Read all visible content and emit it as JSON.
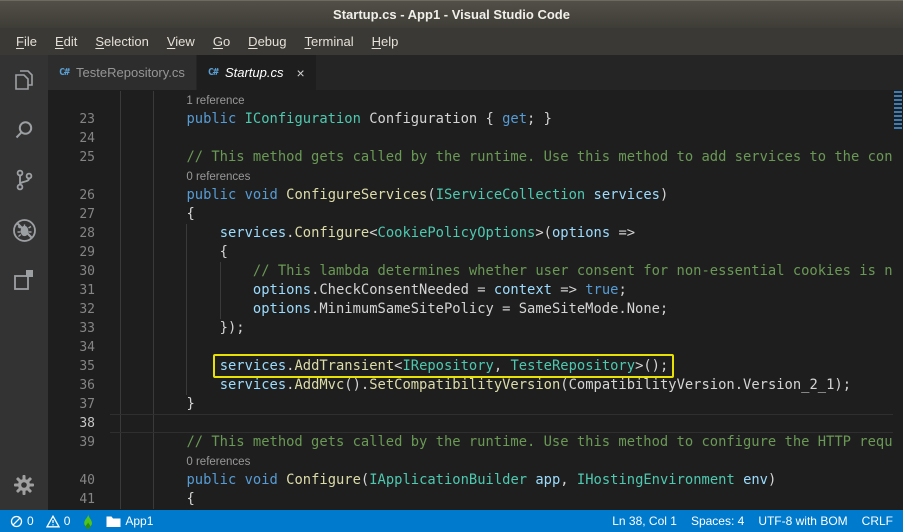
{
  "window": {
    "title": "Startup.cs - App1 - Visual Studio Code"
  },
  "menu": {
    "items": [
      "File",
      "Edit",
      "Selection",
      "View",
      "Go",
      "Debug",
      "Terminal",
      "Help"
    ]
  },
  "activity_bar": {
    "items": [
      {
        "icon": "explorer-icon"
      },
      {
        "icon": "search-icon"
      },
      {
        "icon": "source-control-icon"
      },
      {
        "icon": "debug-icon"
      },
      {
        "icon": "extensions-icon"
      }
    ],
    "bottom_items": [
      {
        "icon": "settings-gear-icon"
      }
    ]
  },
  "tabs": [
    {
      "label": "TesteRepository.cs",
      "icon": "csharp-file-icon",
      "active": false,
      "closable": false
    },
    {
      "label": "Startup.cs",
      "icon": "csharp-file-icon",
      "active": true,
      "preview_italic": true,
      "closable": true,
      "close_glyph": "×"
    }
  ],
  "colors": {
    "accent_blue": "#007acc",
    "keyword": "#569cd6",
    "type": "#4ec9b0",
    "method": "#dcdcaa",
    "variable": "#9cdcfe",
    "comment": "#6a9955",
    "plain": "#d4d4d4",
    "codelens": "#999999",
    "annotation_yellow": "#e8e204"
  },
  "editor": {
    "annotation": {
      "type": "highlight-box",
      "line": 35
    },
    "current_line": 38,
    "rows": [
      {
        "kind": "lens",
        "indent": 8,
        "text": "1 reference",
        "guides": [
          0,
          4
        ]
      },
      {
        "kind": "code",
        "num": "23",
        "guides": [
          0,
          4
        ],
        "tokens": [
          [
            "pl",
            "        "
          ],
          [
            "kw",
            "public"
          ],
          [
            "pl",
            " "
          ],
          [
            "ty",
            "IConfiguration"
          ],
          [
            "pl",
            " Configuration { "
          ],
          [
            "kw",
            "get"
          ],
          [
            "pl",
            "; }"
          ]
        ]
      },
      {
        "kind": "code",
        "num": "24",
        "guides": [
          0,
          4
        ],
        "tokens": []
      },
      {
        "kind": "code",
        "num": "25",
        "guides": [
          0,
          4
        ],
        "tokens": [
          [
            "pl",
            "        "
          ],
          [
            "cm",
            "// This method gets called by the runtime. Use this method to add services to the container."
          ]
        ]
      },
      {
        "kind": "lens",
        "indent": 8,
        "text": "0 references",
        "guides": [
          0,
          4
        ]
      },
      {
        "kind": "code",
        "num": "26",
        "guides": [
          0,
          4
        ],
        "tokens": [
          [
            "pl",
            "        "
          ],
          [
            "kw",
            "public"
          ],
          [
            "pl",
            " "
          ],
          [
            "kw",
            "void"
          ],
          [
            "pl",
            " "
          ],
          [
            "fn",
            "ConfigureServices"
          ],
          [
            "pl",
            "("
          ],
          [
            "ty",
            "IServiceCollection"
          ],
          [
            "pl",
            " "
          ],
          [
            "va",
            "services"
          ],
          [
            "pl",
            ")"
          ]
        ]
      },
      {
        "kind": "code",
        "num": "27",
        "guides": [
          0,
          4
        ],
        "tokens": [
          [
            "pl",
            "        {"
          ]
        ]
      },
      {
        "kind": "code",
        "num": "28",
        "guides": [
          0,
          4,
          8
        ],
        "tokens": [
          [
            "pl",
            "            "
          ],
          [
            "va",
            "services"
          ],
          [
            "pl",
            "."
          ],
          [
            "fn",
            "Configure"
          ],
          [
            "pl",
            "<"
          ],
          [
            "ty",
            "CookiePolicyOptions"
          ],
          [
            "pl",
            ">("
          ],
          [
            "va",
            "options"
          ],
          [
            "pl",
            " =>"
          ]
        ]
      },
      {
        "kind": "code",
        "num": "29",
        "guides": [
          0,
          4,
          8
        ],
        "tokens": [
          [
            "pl",
            "            {"
          ]
        ]
      },
      {
        "kind": "code",
        "num": "30",
        "guides": [
          0,
          4,
          8,
          12
        ],
        "tokens": [
          [
            "pl",
            "                "
          ],
          [
            "cm",
            "// This lambda determines whether user consent for non-essential cookies is needed for a given request."
          ]
        ]
      },
      {
        "kind": "code",
        "num": "31",
        "guides": [
          0,
          4,
          8,
          12
        ],
        "tokens": [
          [
            "pl",
            "                "
          ],
          [
            "va",
            "options"
          ],
          [
            "pl",
            ".CheckConsentNeeded = "
          ],
          [
            "va",
            "context"
          ],
          [
            "pl",
            " => "
          ],
          [
            "kw",
            "true"
          ],
          [
            "pl",
            ";"
          ]
        ]
      },
      {
        "kind": "code",
        "num": "32",
        "guides": [
          0,
          4,
          8,
          12
        ],
        "tokens": [
          [
            "pl",
            "                "
          ],
          [
            "va",
            "options"
          ],
          [
            "pl",
            ".MinimumSameSitePolicy = SameSiteMode.None;"
          ]
        ]
      },
      {
        "kind": "code",
        "num": "33",
        "guides": [
          0,
          4,
          8
        ],
        "tokens": [
          [
            "pl",
            "            });"
          ]
        ]
      },
      {
        "kind": "code",
        "num": "34",
        "guides": [
          0,
          4,
          8
        ],
        "tokens": []
      },
      {
        "kind": "code",
        "num": "35",
        "guides": [
          0,
          4,
          8
        ],
        "boxed": true,
        "tokens": [
          [
            "pl",
            "            "
          ],
          [
            "va",
            "services"
          ],
          [
            "pl",
            "."
          ],
          [
            "fn",
            "AddTransient"
          ],
          [
            "pl",
            "<"
          ],
          [
            "ty",
            "IRepository"
          ],
          [
            "pl",
            ", "
          ],
          [
            "ty",
            "TesteRepository"
          ],
          [
            "pl",
            ">();"
          ]
        ]
      },
      {
        "kind": "code",
        "num": "36",
        "guides": [
          0,
          4,
          8
        ],
        "tokens": [
          [
            "pl",
            "            "
          ],
          [
            "va",
            "services"
          ],
          [
            "pl",
            "."
          ],
          [
            "fn",
            "AddMvc"
          ],
          [
            "pl",
            "()."
          ],
          [
            "fn",
            "SetCompatibilityVersion"
          ],
          [
            "pl",
            "(CompatibilityVersion.Version_2_1);"
          ]
        ]
      },
      {
        "kind": "code",
        "num": "37",
        "guides": [
          0,
          4
        ],
        "tokens": [
          [
            "pl",
            "        }"
          ]
        ]
      },
      {
        "kind": "code",
        "num": "38",
        "guides": [
          0,
          4
        ],
        "current": true,
        "tokens": []
      },
      {
        "kind": "code",
        "num": "39",
        "guides": [
          0,
          4
        ],
        "tokens": [
          [
            "pl",
            "        "
          ],
          [
            "cm",
            "// This method gets called by the runtime. Use this method to configure the HTTP request pipeline."
          ]
        ]
      },
      {
        "kind": "lens",
        "indent": 8,
        "text": "0 references",
        "guides": [
          0,
          4
        ]
      },
      {
        "kind": "code",
        "num": "40",
        "guides": [
          0,
          4
        ],
        "tokens": [
          [
            "pl",
            "        "
          ],
          [
            "kw",
            "public"
          ],
          [
            "pl",
            " "
          ],
          [
            "kw",
            "void"
          ],
          [
            "pl",
            " "
          ],
          [
            "fn",
            "Configure"
          ],
          [
            "pl",
            "("
          ],
          [
            "ty",
            "IApplicationBuilder"
          ],
          [
            "pl",
            " "
          ],
          [
            "va",
            "app"
          ],
          [
            "pl",
            ", "
          ],
          [
            "ty",
            "IHostingEnvironment"
          ],
          [
            "pl",
            " "
          ],
          [
            "va",
            "env"
          ],
          [
            "pl",
            ")"
          ]
        ]
      },
      {
        "kind": "code",
        "num": "41",
        "guides": [
          0,
          4
        ],
        "tokens": [
          [
            "pl",
            "        {"
          ]
        ]
      }
    ]
  },
  "statusbar": {
    "left": [
      {
        "icon": "error-icon",
        "label": "0"
      },
      {
        "icon": "warning-icon",
        "label": "0"
      },
      {
        "icon": "flame-icon",
        "label": ""
      },
      {
        "icon": "folder-icon",
        "label": "App1"
      }
    ],
    "right": [
      {
        "label": "Ln 38, Col 1"
      },
      {
        "label": "Spaces: 4"
      },
      {
        "label": "UTF-8 with BOM"
      },
      {
        "label": "CRLF"
      }
    ]
  }
}
